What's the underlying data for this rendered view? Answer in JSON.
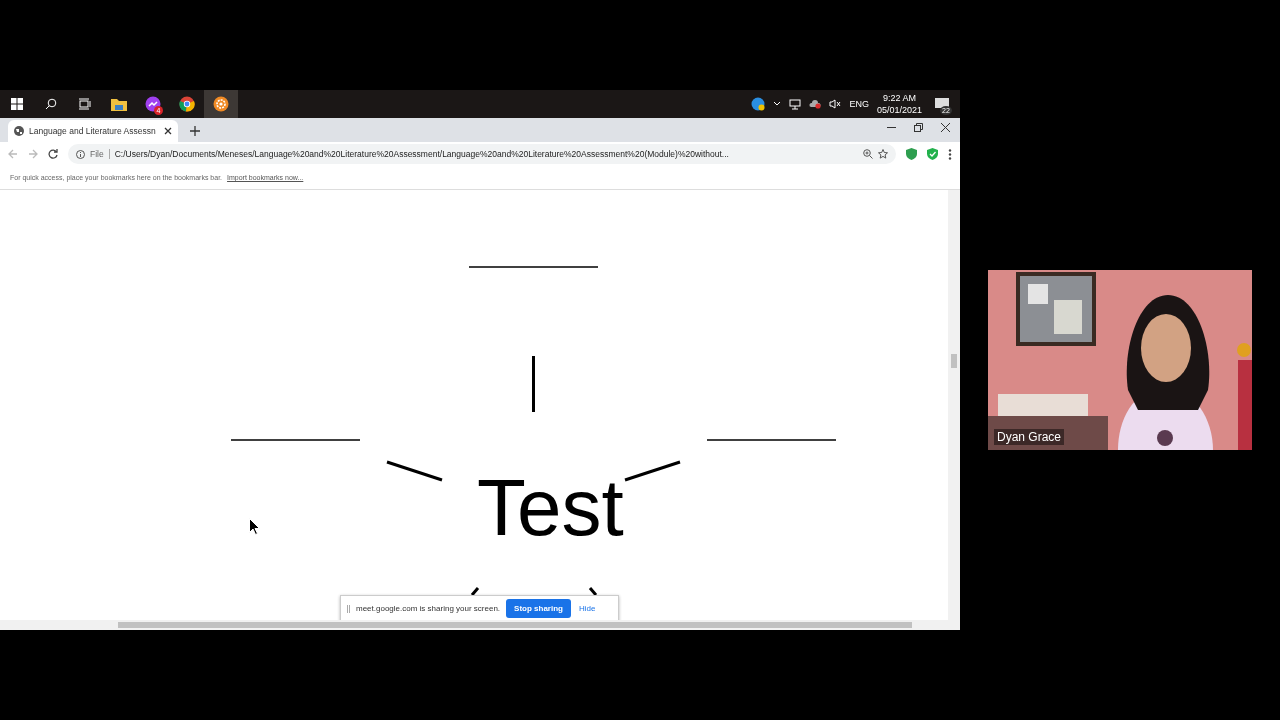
{
  "taskbar": {
    "apps": [
      {
        "kind": "folder",
        "selected": false
      },
      {
        "kind": "messenger",
        "badge": "4",
        "selected": false
      },
      {
        "kind": "chrome",
        "selected": false
      },
      {
        "kind": "gear",
        "selected": true
      }
    ],
    "tray": {
      "language": "ENG",
      "time": "9:22 AM",
      "date": "05/01/2021",
      "notifications": "22"
    }
  },
  "browser": {
    "tab": {
      "title": "Language and Literature Assessn"
    },
    "address": {
      "scheme": "File",
      "url": "C:/Users/Dyan/Documents/Meneses/Language%20and%20Literature%20Assessment/Language%20and%20Literature%20Assessment%20(Module)%20without..."
    },
    "bookmarks_bar": {
      "hint": "For quick access, place your bookmarks here on the bookmarks bar.",
      "link": "Import bookmarks now..."
    }
  },
  "document": {
    "word": "Test"
  },
  "share_bar": {
    "message": "meet.google.com is sharing your screen.",
    "stop": "Stop sharing",
    "hide": "Hide"
  },
  "participant": {
    "name": "Dyan Grace",
    "kind": "picture"
  }
}
